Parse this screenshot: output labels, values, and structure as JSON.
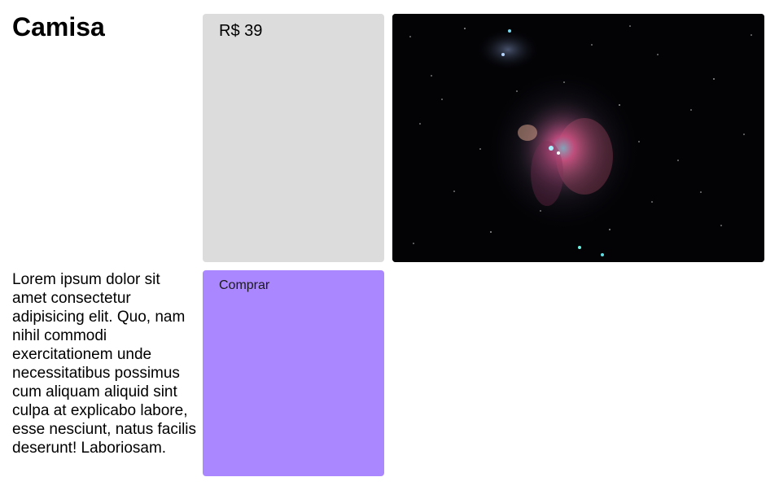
{
  "product": {
    "title": "Camisa",
    "price": "R$ 39",
    "description": "Lorem ipsum dolor sit amet consectetur adipisicing elit. Quo, nam nihil commodi exercitationem unde necessitatibus possimus cum aliquam aliquid sint culpa at explicabo labore, esse nesciunt, natus facilis deserunt! Laboriosam.",
    "buy_label": "Comprar",
    "image_subject": "nebula-space-photo"
  },
  "colors": {
    "price_card": "#dcdcdc",
    "buy_button": "#ab87ff",
    "image_background": "#030306"
  }
}
